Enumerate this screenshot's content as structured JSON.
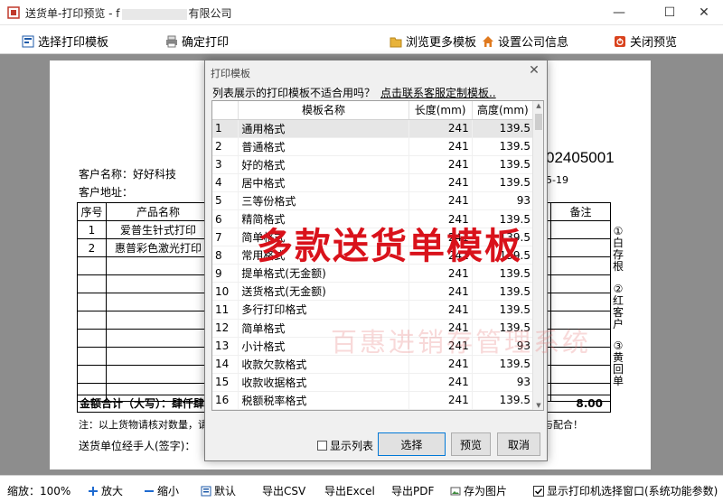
{
  "window": {
    "title_prefix": "送货单-打印预览 - f",
    "title_suffix": "有限公司",
    "minimize": "—",
    "maximize": "☐",
    "close": "✕"
  },
  "toolbar": {
    "select_template": "选择打印模板",
    "confirm_print": "确定打印",
    "browse_more": "浏览更多模板",
    "company_info": "设置公司信息",
    "close_preview": "关闭预览"
  },
  "document": {
    "doc_number": "02405001",
    "doc_date": "5-19",
    "customer_name_label": "客户名称：好好科技",
    "customer_address_label": "客户地址：",
    "columns": [
      "序号",
      "产品名称",
      "备注"
    ],
    "rows": [
      {
        "no": "1",
        "product": "爱普生针式打印"
      },
      {
        "no": "2",
        "product": "惠普彩色激光打印"
      }
    ],
    "total_label": "金额合计（大写）：肆仟肆佰",
    "total_right": "8.00",
    "note_left": "注：以上货物请核对数量，请",
    "note_right": "与配合！",
    "signature_label": "送货单位经手人(签字)：",
    "side_labels": [
      "①白存根",
      "②红客户",
      "③黄回单"
    ]
  },
  "dialog": {
    "title": "打印模板",
    "close": "✕",
    "question": "列表展示的打印模板不适合用吗？",
    "link": "点击联系客服定制模板..",
    "headers": [
      "",
      "模板名称",
      "长度(mm)",
      "高度(mm)"
    ],
    "templates": [
      {
        "no": "1",
        "name": "通用格式",
        "length": "241",
        "height": "139.5"
      },
      {
        "no": "2",
        "name": "普通格式",
        "length": "241",
        "height": "139.5"
      },
      {
        "no": "3",
        "name": "好的格式",
        "length": "241",
        "height": "139.5"
      },
      {
        "no": "4",
        "name": "居中格式",
        "length": "241",
        "height": "139.5"
      },
      {
        "no": "5",
        "name": "三等份格式",
        "length": "241",
        "height": "93"
      },
      {
        "no": "6",
        "name": "精简格式",
        "length": "241",
        "height": "139.5"
      },
      {
        "no": "7",
        "name": "简单格式",
        "length": "241",
        "height": "139.5"
      },
      {
        "no": "8",
        "name": "常用格式",
        "length": "241",
        "height": "139.5"
      },
      {
        "no": "9",
        "name": "提单格式(无金额)",
        "length": "241",
        "height": "139.5"
      },
      {
        "no": "10",
        "name": "送货格式(无金额)",
        "length": "241",
        "height": "139.5"
      },
      {
        "no": "11",
        "name": "多行打印格式",
        "length": "241",
        "height": "139.5"
      },
      {
        "no": "12",
        "name": "简单格式",
        "length": "241",
        "height": "139.5"
      },
      {
        "no": "13",
        "name": "小计格式",
        "length": "241",
        "height": "93"
      },
      {
        "no": "14",
        "name": "收款欠款格式",
        "length": "241",
        "height": "139.5"
      },
      {
        "no": "15",
        "name": "收款收据格式",
        "length": "241",
        "height": "93"
      },
      {
        "no": "16",
        "name": "税额税率格式",
        "length": "241",
        "height": "139.5"
      }
    ],
    "show_list": "显示列表",
    "select_btn": "选择",
    "preview_btn": "预览",
    "cancel_btn": "取消"
  },
  "overlay": {
    "headline": "多款送货单模板",
    "watermark": "百惠进销存管理系统"
  },
  "statusbar": {
    "zoom": "缩放：100%",
    "zoom_in": "放大",
    "zoom_out": "缩小",
    "default": "默认",
    "export_csv": "导出CSV",
    "export_excel": "导出Excel",
    "export_pdf": "导出PDF",
    "save_image": "存为图片",
    "show_printer": "显示打印机选择窗口(系统功能参数)"
  },
  "colors": {
    "accent_red": "#d9121b",
    "canvas_gray": "#8d8d8d"
  }
}
